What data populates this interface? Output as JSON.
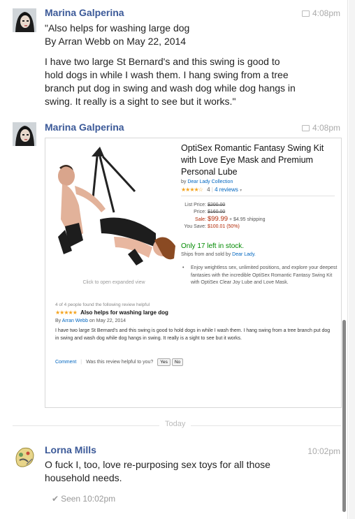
{
  "messages": [
    {
      "sender": "Marina Galperina",
      "time": "4:08pm",
      "quote_lines": [
        "\"Also helps for washing large dog",
        "By Arran Webb on May 22, 2014"
      ],
      "body_lines": [
        "I have two large St Bernard's and this swing is good to",
        "hold dogs in while I wash them. I hang swing from a tree",
        "branch put dog in swing and wash dog while dog hangs in",
        "swing. It really is a sight to see but it works.\""
      ]
    },
    {
      "sender": "Marina Galperina",
      "time": "4:08pm",
      "attachment": {
        "title": "OptiSex Romantic Fantasy Swing Kit with Love Eye Mask and Premium Personal Lube",
        "by_prefix": "by",
        "brand": "Dear Lady Collection",
        "stars": "★★★★☆",
        "rating_count": "4",
        "reviews_link": "4 reviews",
        "list_price_label": "List Price:",
        "list_price": "$200.00",
        "price_label": "Price:",
        "price": "$160.00",
        "sale_label": "Sale:",
        "sale_price": "$99.99",
        "shipping": "+ $4.95 shipping",
        "you_save_label": "You Save:",
        "you_save": "$100.01 (50%)",
        "stock": "Only 17 left in stock.",
        "ships_from": "Ships from and sold by",
        "ships_from_link": "Dear Lady.",
        "bullet": "Enjoy weightless sex, unlimited positions, and explore your deepest fantasies with the incredible OptiSex Romantic Fantasy Swing Kit with OptiSex Clear Joy Lube and Love Mask.",
        "image_caption": "Click to open expanded view",
        "helpful_note": "4 of 4 people found the following review helpful",
        "review_stars": "★★★★★",
        "review_title": "Also helps for washing large dog",
        "review_by": "By",
        "review_author": "Arran Webb",
        "review_date": "on May 22, 2014",
        "review_text": "I have two large St Bernard's and this swing is good to hold dogs in while I wash them. I hang swing from a tree branch put dog in swing and wash dog while dog hangs in swing. It really is a sight to see but it works.",
        "comment_link": "Comment",
        "helpful_question": "Was this review helpful to you?",
        "yes_label": "Yes",
        "no_label": "No"
      }
    },
    {
      "sender": "Lorna Mills",
      "time": "10:02pm",
      "body_lines": [
        "O fuck I, too, love re-purposing sex toys for all those",
        "household needs."
      ]
    }
  ],
  "divider_label": "Today",
  "seen": "Seen 10:02pm",
  "colors": {
    "name": "#3b5998",
    "link": "#0066c0",
    "sale": "#b12704",
    "stock": "#008a00",
    "stars": "#f4a31d"
  }
}
